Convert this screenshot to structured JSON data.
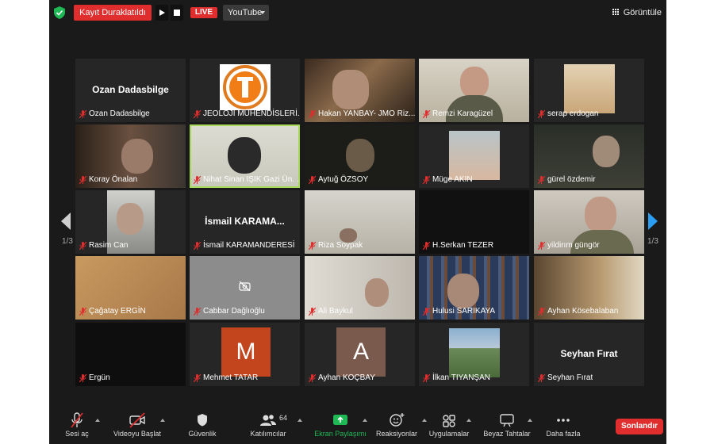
{
  "topbar": {
    "recording_status": "Kayıt Duraklatıldı",
    "live_badge": "LIVE",
    "stream_target": "YouTube",
    "view_label": "Görüntüle"
  },
  "pager": {
    "left": "1/3",
    "right": "1/3"
  },
  "participants": [
    {
      "name": "Ozan Dadasbilge",
      "display": "Ozan Dadasbilge"
    },
    {
      "name": "JEOLOJİ MÜHENDİSLERİ..."
    },
    {
      "name": "Hakan YANBAY- JMO Riz..."
    },
    {
      "name": "Remzi Karagüzel"
    },
    {
      "name": "serap erdogan"
    },
    {
      "name": "Koray Önalan"
    },
    {
      "name": "Nihat Sinan IŞIK Gazi Ün. J..."
    },
    {
      "name": "Aytuğ ÖZSOY"
    },
    {
      "name": "Müge AKIN"
    },
    {
      "name": "gürel özdemir"
    },
    {
      "name": "Rasim Can"
    },
    {
      "name": "İsmail KARAMANDERESİ",
      "display": "İsmail KARAMA..."
    },
    {
      "name": "Riza Soypak"
    },
    {
      "name": "H.Serkan TEZER"
    },
    {
      "name": "yildirım güngör"
    },
    {
      "name": "Çağatay ERGİN"
    },
    {
      "name": "Cabbar Dağlıoğlu"
    },
    {
      "name": "Ali Baykul"
    },
    {
      "name": "Hulusi SARIKAYA"
    },
    {
      "name": "Ayhan Kösebalaban"
    },
    {
      "name": "Ergün"
    },
    {
      "name": "Mehmet TATAR",
      "initial": "M",
      "color": "#c2451e"
    },
    {
      "name": "Ayhan KOÇBAY",
      "initial": "A",
      "color": "#7a5a4c"
    },
    {
      "name": "İlkan TIYANŞAN"
    },
    {
      "name": "Seyhan Fırat",
      "display": "Seyhan Fırat"
    }
  ],
  "toolbar": {
    "mute": "Sesi aç",
    "video": "Videoyu Başlat",
    "security": "Güvenlik",
    "participants": "Katılımcılar",
    "participant_count": "64",
    "share": "Ekran Paylaşımı",
    "reactions": "Reaksiyonlar",
    "apps": "Uygulamalar",
    "whiteboard": "Beyaz Tahtalar",
    "more": "Daha fazla",
    "end": "Sonlandır"
  },
  "colors": {
    "accent_red": "#e02d2d",
    "active_speaker": "#a6d85a",
    "share_green": "#1fb855"
  }
}
